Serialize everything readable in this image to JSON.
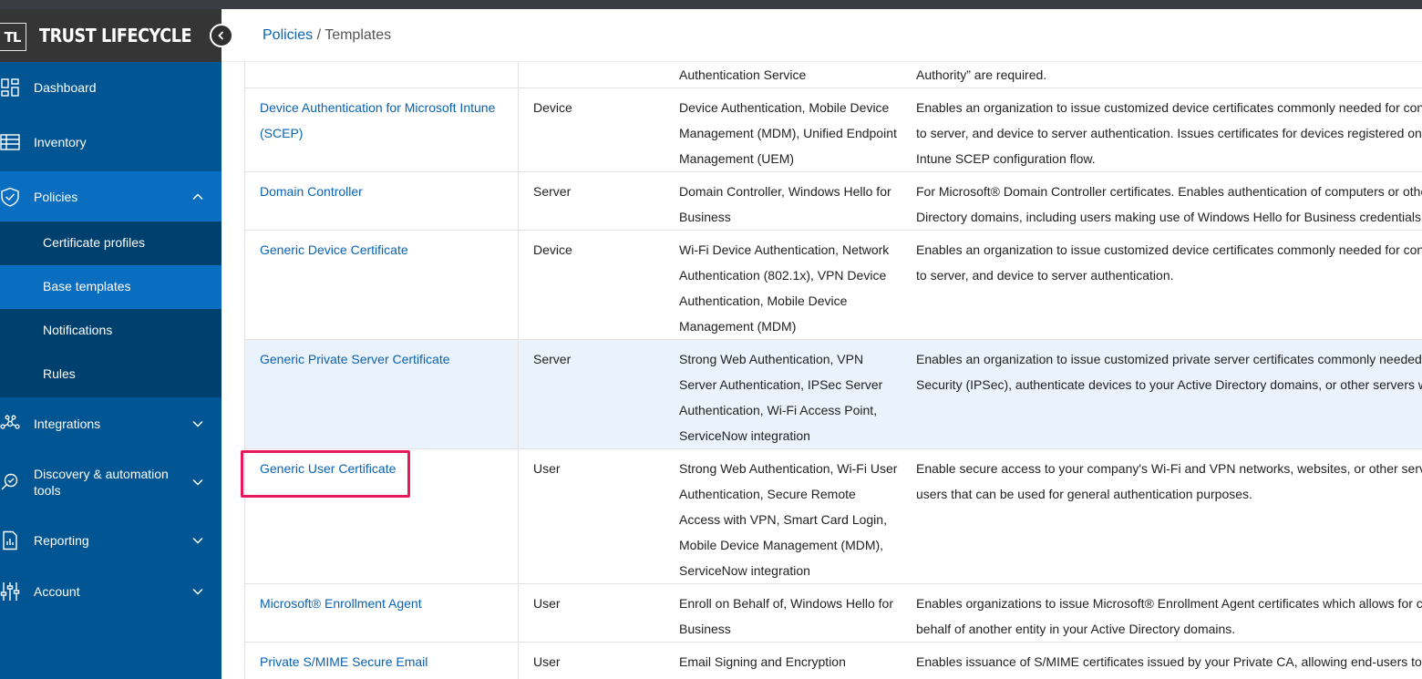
{
  "brand": {
    "logo_text": "TL",
    "name": "TRUST LIFECYCLE"
  },
  "sidebar": {
    "items": [
      {
        "label": "Dashboard",
        "icon": "dashboard-icon"
      },
      {
        "label": "Inventory",
        "icon": "inventory-icon"
      },
      {
        "label": "Policies",
        "icon": "shield-icon",
        "expanded": true
      },
      {
        "label": "Integrations",
        "icon": "integrations-icon"
      },
      {
        "label": "Discovery & automation tools",
        "icon": "discovery-icon"
      },
      {
        "label": "Reporting",
        "icon": "report-icon"
      },
      {
        "label": "Account",
        "icon": "sliders-icon"
      }
    ],
    "subitems": [
      {
        "label": "Certificate profiles"
      },
      {
        "label": "Base templates",
        "active": true
      },
      {
        "label": "Notifications"
      },
      {
        "label": "Rules"
      }
    ]
  },
  "breadcrumb": {
    "parent": "Policies",
    "separator": " / ",
    "current": "Templates"
  },
  "table": {
    "rows": [
      {
        "name": "",
        "type": "",
        "use": "Authentication Service",
        "desc": "Authority” are required."
      },
      {
        "name": "Device Authentication for Microsoft Intune (SCEP)",
        "type": "Device",
        "use": "Device Authentication, Mobile Device Management (MDM), Unified Endpoint Management (UEM)",
        "desc": "Enables an organization to issue customized device certificates commonly needed for con\nto server, and device to server authentication. Issues certificates for devices registered on\nIntune SCEP configuration flow."
      },
      {
        "name": "Domain Controller",
        "type": "Server",
        "use": "Domain Controller, Windows Hello for Business",
        "desc": "For Microsoft® Domain Controller certificates. Enables authentication of computers or othe\nDirectory domains, including users making use of Windows Hello for Business credentials."
      },
      {
        "name": "Generic Device Certificate",
        "type": "Device",
        "use": "Wi-Fi Device Authentication, Network Authentication (802.1x), VPN Device Authentication, Mobile Device Management (MDM)",
        "desc": "Enables an organization to issue customized device certificates commonly needed for con\nto server, and device to server authentication."
      },
      {
        "name": "Generic Private Server Certificate",
        "type": "Server",
        "use": "Strong Web Authentication, VPN Server Authentication, IPSec Server Authentication, Wi-Fi Access Point, ServiceNow integration",
        "desc": "Enables an organization to issue customized private server certificates commonly needed\nSecurity (IPSec), authenticate devices to your Active Directory domains, or other servers w"
      },
      {
        "name": "Generic User Certificate",
        "type": "User",
        "use": "Strong Web Authentication, Wi-Fi User Authentication, Secure Remote Access with VPN, Smart Card Login, Mobile Device Management (MDM), ServiceNow integration",
        "desc": "Enable secure access to your company's Wi-Fi and VPN networks, websites, or other serv\nusers that can be used for general authentication purposes."
      },
      {
        "name": "Microsoft® Enrollment Agent",
        "type": "User",
        "use": "Enroll on Behalf of, Windows Hello for Business",
        "desc": "Enables organizations to issue Microsoft® Enrollment Agent certificates which allows for c\nbehalf of another entity in your Active Directory domains."
      },
      {
        "name": "Private S/MIME Secure Email",
        "type": "User",
        "use": "Email Signing and Encryption",
        "desc": "Enables issuance of S/MIME certificates issued by your Private CA, allowing end-users to"
      }
    ]
  },
  "colors": {
    "sidebar": "#005592",
    "sidebar_active": "#0a6ec0",
    "subnav": "#00406f",
    "link": "#0a62b1",
    "highlight": "#e6185b",
    "row_highlight": "#eaf3fc"
  }
}
